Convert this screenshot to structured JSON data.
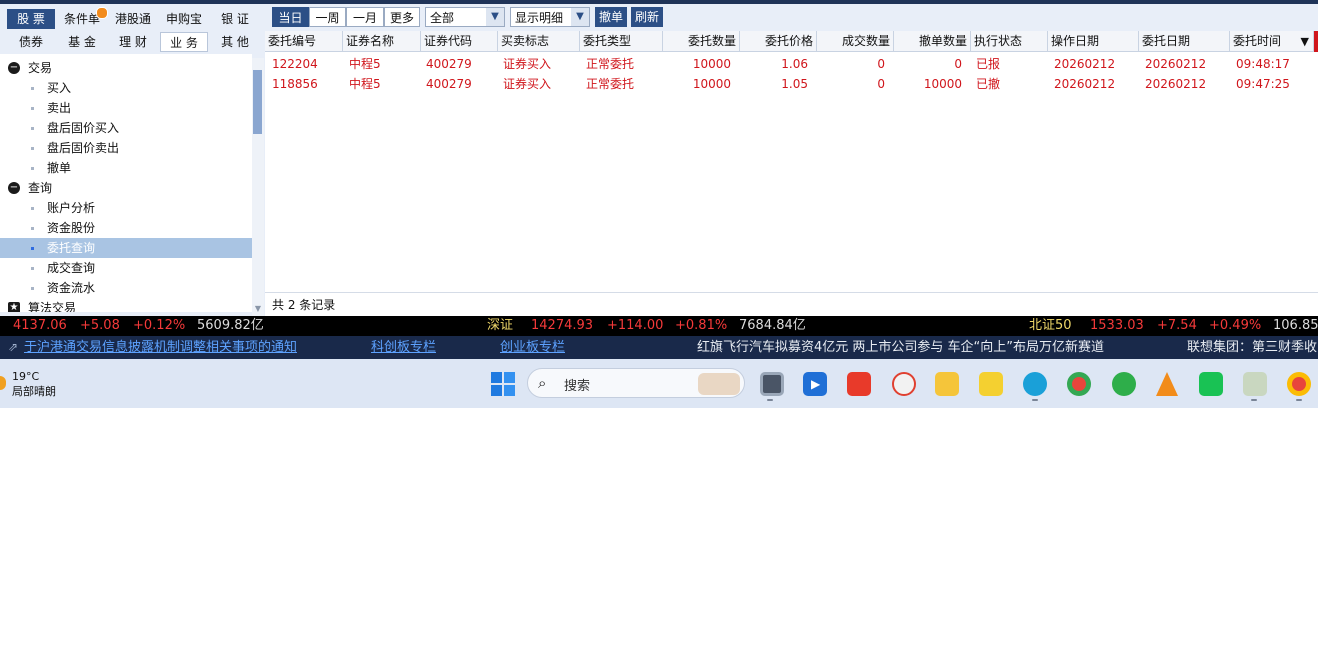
{
  "left_tabs_row1": [
    "股 票",
    "条件单",
    "港股通",
    "申购宝",
    "银 证"
  ],
  "left_tabs_row2": [
    "债券",
    "基 金",
    "理 财",
    "业 务",
    "其 他"
  ],
  "tree": {
    "groups": [
      {
        "label": "交易",
        "icon": "collapse-icon"
      },
      {
        "label": "查询",
        "icon": "collapse-icon"
      },
      {
        "label": "算法交易",
        "icon": "star-icon"
      }
    ],
    "trade_items": [
      "买入",
      "卖出",
      "盘后固价买入",
      "盘后固价卖出",
      "撤单"
    ],
    "query_items": [
      "账户分析",
      "资金股份",
      "委托查询",
      "成交查询",
      "资金流水"
    ],
    "selected": "委托查询"
  },
  "toolbar": {
    "periods": [
      "当日",
      "一周",
      "一月",
      "更多"
    ],
    "filter_select": "全部",
    "display_select": "显示明细",
    "cancel_button": "撤单",
    "refresh_button": "刷新"
  },
  "table": {
    "columns": [
      "委托编号",
      "证券名称",
      "证券代码",
      "买卖标志",
      "委托类型",
      "委托数量",
      "委托价格",
      "成交数量",
      "撤单数量",
      "执行状态",
      "操作日期",
      "委托日期",
      "委托时间"
    ],
    "rows": [
      [
        "122204",
        "中程5",
        "400279",
        "证券买入",
        "正常委托",
        "10000",
        "1.06",
        "0",
        "0",
        "已报",
        "20260212",
        "20260212",
        "09:48:17"
      ],
      [
        "118856",
        "中程5",
        "400279",
        "证券买入",
        "正常委托",
        "10000",
        "1.05",
        "0",
        "10000",
        "已撤",
        "20260212",
        "20260212",
        "09:47:25"
      ]
    ],
    "footer": "共 2 条记录"
  },
  "ticker": {
    "seg1": {
      "value": "4137.06",
      "change": "+5.08",
      "pct": "+0.12%",
      "amount": "5609.82亿"
    },
    "seg2": {
      "name": "深证",
      "value": "14274.93",
      "change": "+114.00",
      "pct": "+0.81%",
      "amount": "7684.84亿"
    },
    "seg3": {
      "name": "北证50",
      "value": "1533.03",
      "change": "+7.54",
      "pct": "+0.49%",
      "amount": "106.85"
    }
  },
  "news": {
    "link1": "于沪港通交易信息披露机制调整相关事项的通知",
    "link2": "科创板专栏",
    "link3": "创业板专栏",
    "headline1": "红旗飞行汽车拟募资4亿元 两上市公司参与 车企“向上”布局万亿新赛道",
    "headline2": "联想集团：第三财季收"
  },
  "taskbar": {
    "temp": "19°C",
    "weather": "局部晴朗",
    "search_placeholder": "搜索"
  },
  "colors": {
    "accent": "#2c4f86",
    "up": "#d0161c",
    "ticker_bg": "#000000",
    "news_bg": "#19294a"
  }
}
